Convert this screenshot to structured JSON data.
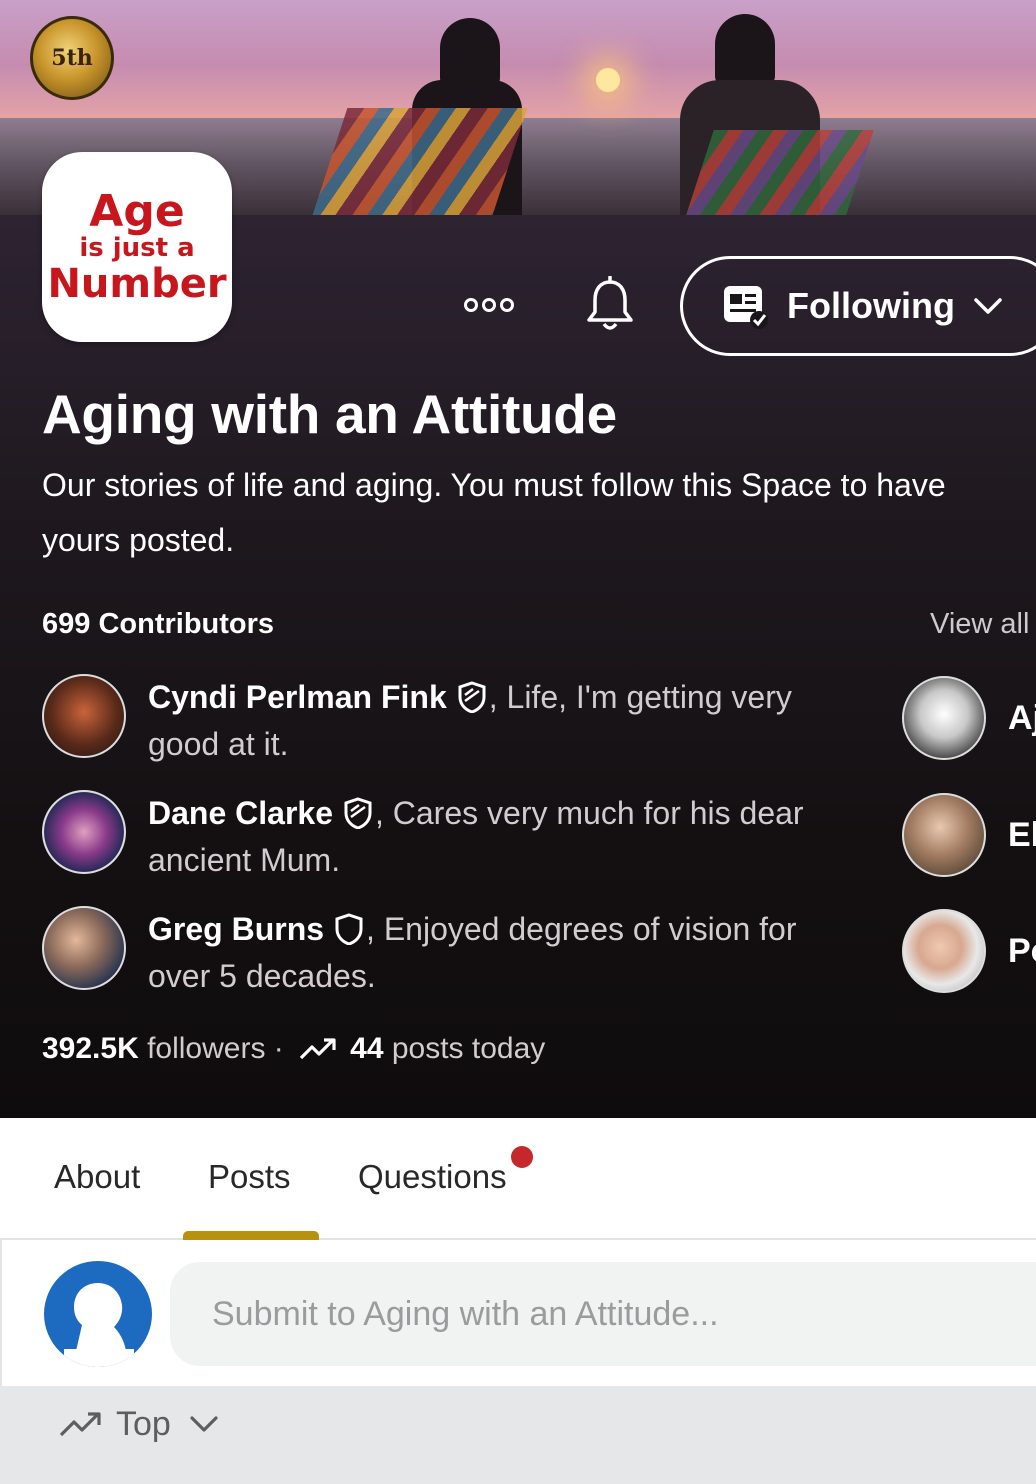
{
  "cover": {
    "badge_text": "5th"
  },
  "logo": {
    "line1": "Age",
    "line2": "is just a",
    "line3": "Number"
  },
  "actions": {
    "follow_label": "Following"
  },
  "space": {
    "title": "Aging with an Attitude",
    "description": "Our stories of life and aging. You must follow this Space to have yours posted."
  },
  "contributors": {
    "count_label": "699 Contributors",
    "view_all": "View all",
    "left": [
      {
        "name": "Cyndi Perlman Fink",
        "tagline": ", Life, I'm getting very good at it."
      },
      {
        "name": "Dane Clarke",
        "tagline": ", Cares very much for his dear ancient Mum."
      },
      {
        "name": "Greg Burns",
        "tagline": ", Enjoyed degrees of vision for over 5 decades."
      }
    ],
    "right": [
      {
        "name": "Aj"
      },
      {
        "name": "El"
      },
      {
        "name": "Po"
      }
    ]
  },
  "stats": {
    "followers": "392.5K",
    "followers_label": " followers",
    "separator": " · ",
    "posts_today": "44",
    "posts_label": " posts today"
  },
  "tabs": [
    {
      "label": "About"
    },
    {
      "label": "Posts"
    },
    {
      "label": "Questions"
    }
  ],
  "composer": {
    "placeholder": "Submit to Aging with an Attitude..."
  },
  "sort": {
    "label": "Top"
  },
  "colors": {
    "accent": "#b8920f",
    "notify_dot": "#c5282a",
    "brand_red": "#c8161d",
    "avatar_blue": "#1c6bc0"
  }
}
